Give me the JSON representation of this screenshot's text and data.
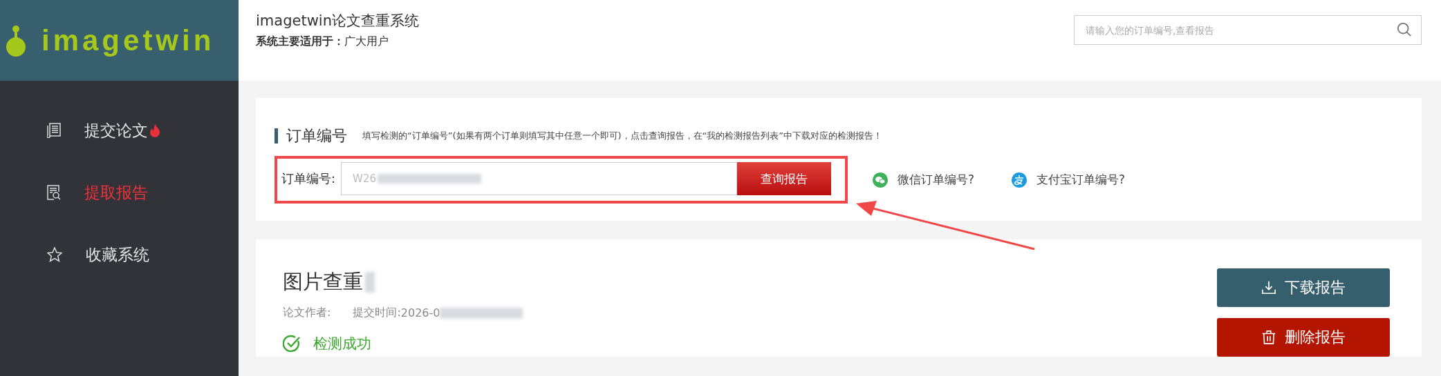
{
  "logo": {
    "text": "imagetwin"
  },
  "sidebar": {
    "items": [
      {
        "kind": "document",
        "label": "提交论文",
        "hot": true,
        "selected": false
      },
      {
        "kind": "report-search",
        "label": "提取报告",
        "hot": false,
        "selected": true
      },
      {
        "kind": "star",
        "label": "收藏系统",
        "hot": false,
        "selected": false
      }
    ]
  },
  "header": {
    "title": "imagetwin论文查重系统",
    "subtitle_label": "系统主要适用于：",
    "subtitle_value": "广大用户",
    "search": {
      "placeholder": "请输入您的订单编号,查看报告"
    }
  },
  "order_section": {
    "title": "订单编号",
    "hint": "填写检测的“订单编号”(如果有两个订单则填写其中任意一个即可)，点击查询报告，在“我的检测报告列表”中下载对应的检测报告！",
    "field_label": "订单编号:",
    "field_value": "W26",
    "field_redacted": true,
    "query_button": "查询报告",
    "links": [
      {
        "kind": "wechat",
        "label": "微信订单编号?"
      },
      {
        "kind": "alipay",
        "label": "支付宝订单编号?"
      }
    ]
  },
  "report": {
    "title": "图片查重",
    "title_redacted": true,
    "author_label": "论文作者:",
    "time_label": "提交时间:",
    "time_value": "2026-0",
    "time_redacted": true,
    "status": "检测成功",
    "buttons": [
      {
        "kind": "download",
        "label": "下载报告"
      },
      {
        "kind": "delete",
        "label": "删除报告"
      }
    ]
  }
}
